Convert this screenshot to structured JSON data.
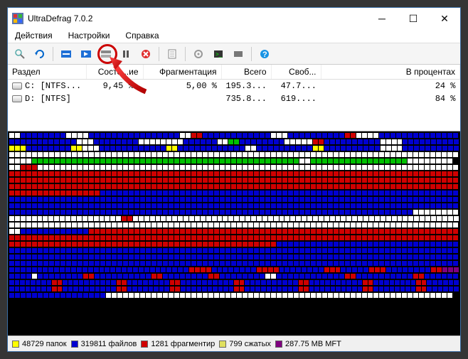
{
  "title": "UltraDefrag 7.0.2",
  "menu": {
    "actions": "Действия",
    "settings": "Настройки",
    "help": "Справка"
  },
  "columns": {
    "part": "Раздел",
    "state": "Состо...ие",
    "frag": "Фрагментация",
    "total": "Всего",
    "free": "Своб...",
    "percent": "В процентах"
  },
  "rows": [
    {
      "name": "C: [NTFS...",
      "state": "9,45 %.",
      "frag": "5,00 %",
      "total": "195.3...",
      "free": "47.7...",
      "percent": "24 %"
    },
    {
      "name": "D: [NTFS]",
      "state": "",
      "frag": "",
      "total": "735.8...",
      "free": "619....",
      "percent": "84 %"
    }
  ],
  "legend": {
    "folders": "48729 папок",
    "files": "319811 файлов",
    "fragm": "1281 фрагментир",
    "compr": "799 сжатых",
    "mft": "287.75 MB MFT"
  },
  "colors": {
    "folders": "#ffff00",
    "files": "#0000d0",
    "fragm": "#d00000",
    "compr": "#e0e060",
    "mft": "#800080",
    "green": "#00c000",
    "white": "#ffffff"
  },
  "icons": {
    "analyze": "magnifier-icon",
    "repeat": "refresh-icon",
    "defrag": "defrag-icon",
    "quick": "quick-icon",
    "full": "full-icon",
    "pause": "pause-icon",
    "stop": "stop-icon",
    "report": "report-icon",
    "options": "gear-icon",
    "script": "terminal-icon",
    "power": "power-icon",
    "help": "help-icon"
  }
}
